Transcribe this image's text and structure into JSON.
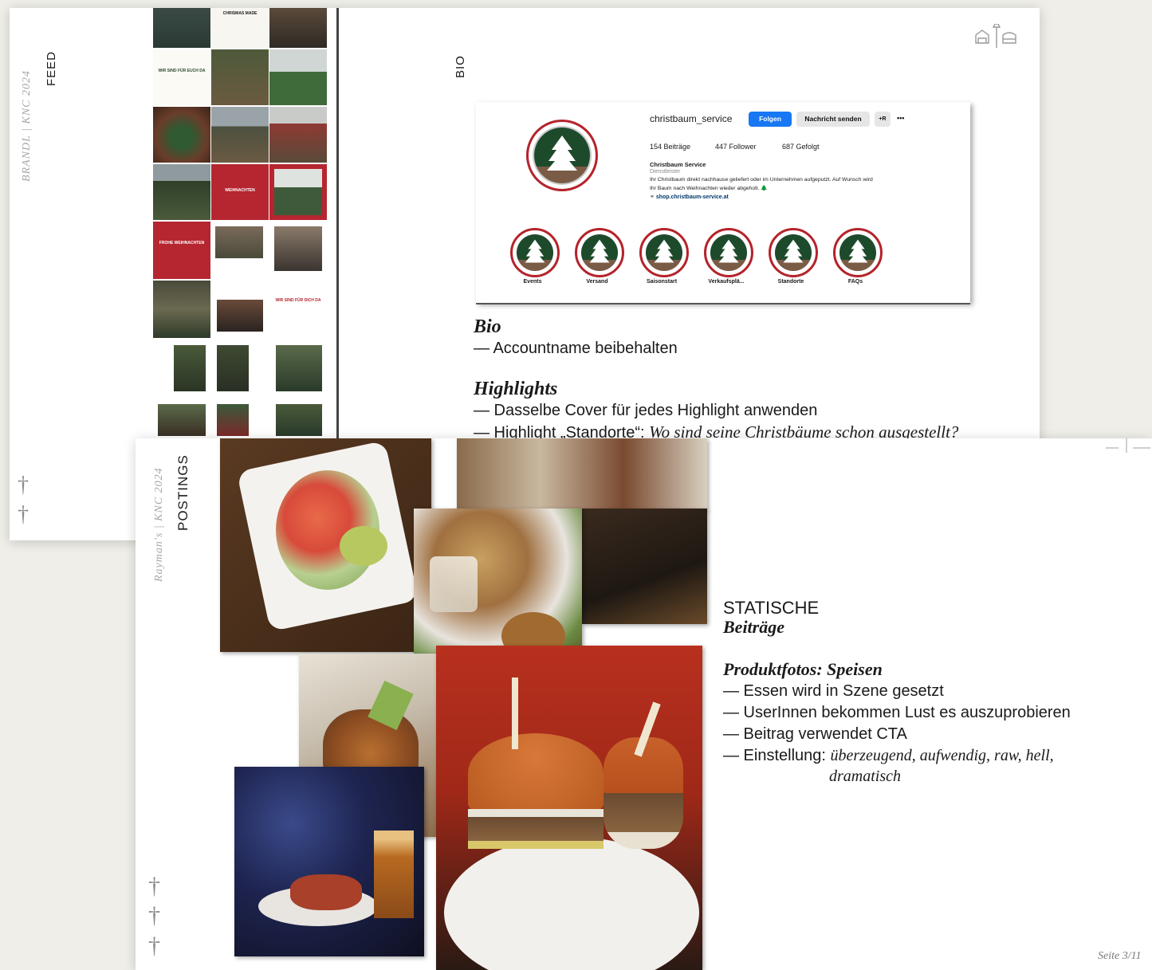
{
  "slide1": {
    "side_label": "BRANDL | KNC 2024",
    "section_feed": "FEED",
    "section_bio": "BIO",
    "instagram": {
      "username": "christbaum_service",
      "follow_label": "Folgen",
      "message_label": "Nachricht senden",
      "add_icon": "+R",
      "more_icon": "•••",
      "posts": "154 Beiträge",
      "followers": "447 Follower",
      "following": "687 Gefolgt",
      "display_name": "Christbaum Service",
      "category": "Dienstleister",
      "bio_line1": "Ihr Christbaum direkt nachhause geliefert oder im Unternehmen aufgeputzt. Auf Wunsch wird",
      "bio_line2": "Ihr Baum nach Weihnachten wieder abgeholt. 🌲",
      "link": "shop.christbaum-service.at",
      "highlights": [
        "Events",
        "Versand",
        "Saisonstart",
        "Verkaufsplä...",
        "Standorte",
        "FAQs"
      ]
    },
    "bio_heading": "Bio",
    "bio_bullet": "— Accountname beibehalten",
    "highlights_heading": "Highlights",
    "highlights_bullet1": "— Dasselbe Cover für jedes Highlight anwenden",
    "highlights_bullet2_prefix": "— Highlight „Standorte“: ",
    "highlights_bullet2_italic": "Wo sind seine Christbäume schon ausgestellt?",
    "feed_tiles": {
      "t1": "CHRISMAS MADE",
      "t2": "WIR SIND FÜR EUCH DA",
      "t3": "WEIHNACHTEN",
      "t4": "FROHE WEIHNACHTEN",
      "t5": "WIR SIND FÜR DICH DA"
    }
  },
  "slide2": {
    "side_label": "Rayman's | KNC 2024",
    "section_postings": "POSTINGS",
    "static_title": "STATISCHE",
    "static_subtitle": "Beiträge",
    "product_heading": "Produktfotos: Speisen",
    "bullets": [
      "— Essen wird in Szene gesetzt",
      "— UserInnen bekommen Lust es auszuprobieren",
      "— Beitrag verwendet CTA"
    ],
    "setting_prefix": "— Einstellung: ",
    "setting_italic_line1": "überzeugend, aufwendig, raw, hell,",
    "setting_italic_line2": "dramatisch",
    "page_number": "Seite 3/11"
  },
  "icons": {
    "corner_logo": "lamp-and-sofa-icon",
    "cross": "cross-icon"
  }
}
